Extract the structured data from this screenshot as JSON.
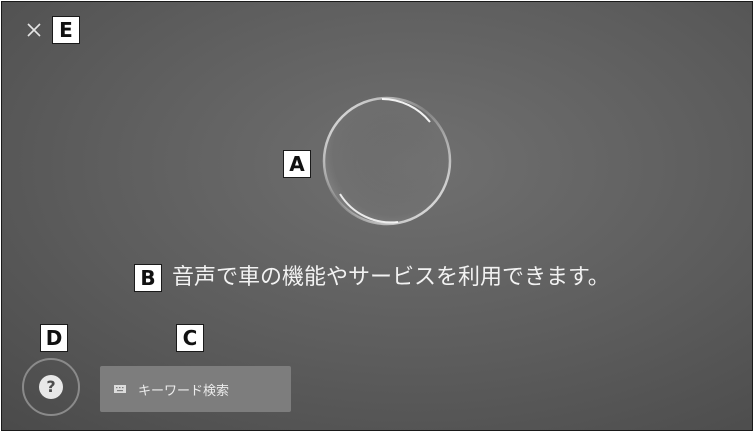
{
  "close": {
    "icon": "close-icon",
    "symbol": "×"
  },
  "callouts": {
    "a": "A",
    "b": "B",
    "c": "C",
    "d": "D",
    "e": "E"
  },
  "message": "音声で車の機能やサービスを利用できます。",
  "help": {
    "icon": "question-icon",
    "symbol": "?"
  },
  "keyword_search": {
    "icon": "keyboard-icon",
    "label": "キーワード検索"
  },
  "colors": {
    "background": "#5c5c5c",
    "text": "#f2f2f2",
    "button": "#7d7d7d"
  }
}
